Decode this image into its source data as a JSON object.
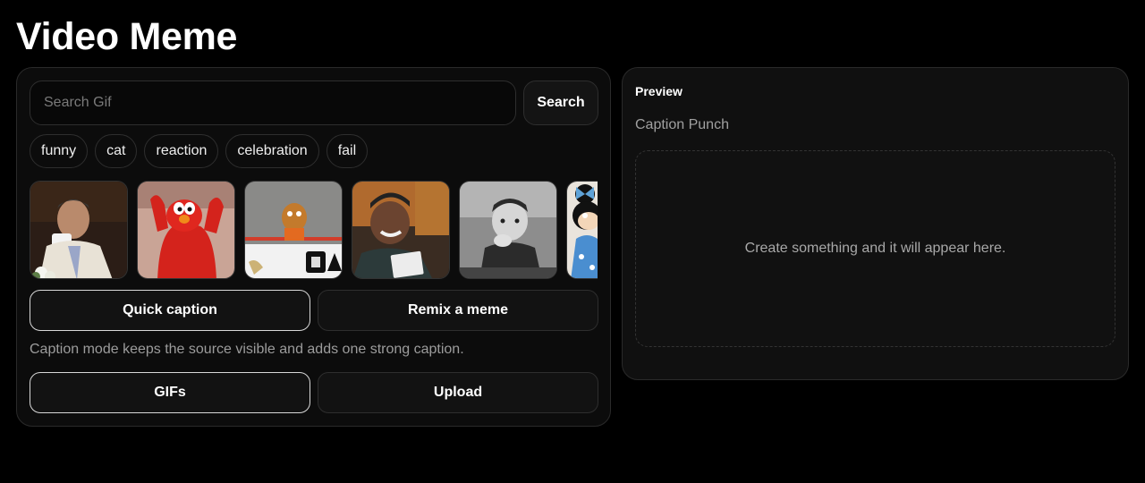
{
  "page": {
    "title": "Video Meme"
  },
  "search": {
    "placeholder": "Search Gif",
    "value": "",
    "button_label": "Search"
  },
  "tags": [
    "funny",
    "cat",
    "reaction",
    "celebration",
    "fail"
  ],
  "gifs": [
    {
      "name": "gif-man-drinking-thumbnail"
    },
    {
      "name": "gif-elmo-thumbnail"
    },
    {
      "name": "gif-mascot-thumbnail"
    },
    {
      "name": "gif-man-laughing-thumbnail"
    },
    {
      "name": "gif-kid-bw-thumbnail"
    },
    {
      "name": "gif-minnie-thumbnail"
    }
  ],
  "modes": {
    "quick_caption": "Quick caption",
    "remix": "Remix a meme",
    "active": "quick_caption"
  },
  "mode_hint": "Caption mode keeps the source visible and adds one strong caption.",
  "sources": {
    "gifs": "GIFs",
    "upload": "Upload",
    "active": "gifs"
  },
  "preview": {
    "label": "Preview",
    "style_name": "Caption Punch",
    "empty_message": "Create something and it will appear here."
  }
}
